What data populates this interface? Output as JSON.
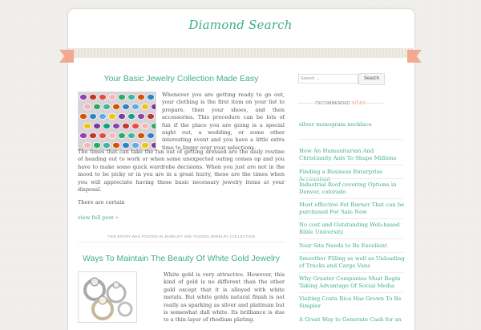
{
  "site": {
    "title": "Diamond Search"
  },
  "colors": {
    "accent": "#3fae88",
    "ribbon": "#f2a891",
    "background": "#f1efec"
  },
  "posts": [
    {
      "title": "Your Basic Jewelry Collection Made Easy",
      "image": "jewelry-gems-image",
      "paragraphs": [
        "Whenever you are getting ready to go out, your clothing is the first item on your list to prepare, then your shoes, and then accessories. This procedure can be lots of fun if the place you are going is a special night out, a wedding, or some other interesting event and you have a little extra time to linger over your selections.",
        "The times that can take the fun out of getting dressed are the daily routine of heading out to work or when some unexpected outing comes up and you have to make some quick wardrobe decisions. When you just are not in the mood to be picky or in you are in a great hurry, these are the times when you will appreciate having these basic necessary jewelry items at your disposal.",
        "There are certain"
      ],
      "read_more": "view full post »",
      "meta": "This entry was posted in Jewelry and tagged Jewelry Collection"
    },
    {
      "title": "Ways To Maintain The Beauty Of White Gold Jewelry",
      "image": "white-gold-rings-image",
      "paragraphs": [
        "White gold is very attractive. However, this kind of gold is no different than the other gold except that it is alloyed with white metals. But white golds natural finish is not really as sparking as silver and platinum but is somewhat dull white. Its brilliance is due to a thin layer of rhodium plating."
      ]
    }
  ],
  "sidebar": {
    "search": {
      "placeholder": "Search ...",
      "button": "Search"
    },
    "recommended": {
      "title_word": "Recommended",
      "title_accent": "sites"
    },
    "recommended_links": [
      "silver monogram necklace"
    ],
    "recent_links": [
      "How An Humanitarian And Christianity Aids To Shape Millions",
      "Finding a Business Enterprise Accountant",
      "Industrial Roof covering Options in Denver, colorado",
      "Most effective Fat Burner That can be purchased For Sale Now",
      "No cost and Outstanding Web-based Bible University",
      "Your Site Needs to Be Excellent",
      "Smoother Filling as well as Unloading of Trucks and Cargo Vans",
      "Why Greater Companies Must Begin Taking Advantage Of Social Media",
      "Visiting Costa Rica Has Grown To Be Simpler",
      "A Great Way to Generate Cash for an"
    ]
  }
}
